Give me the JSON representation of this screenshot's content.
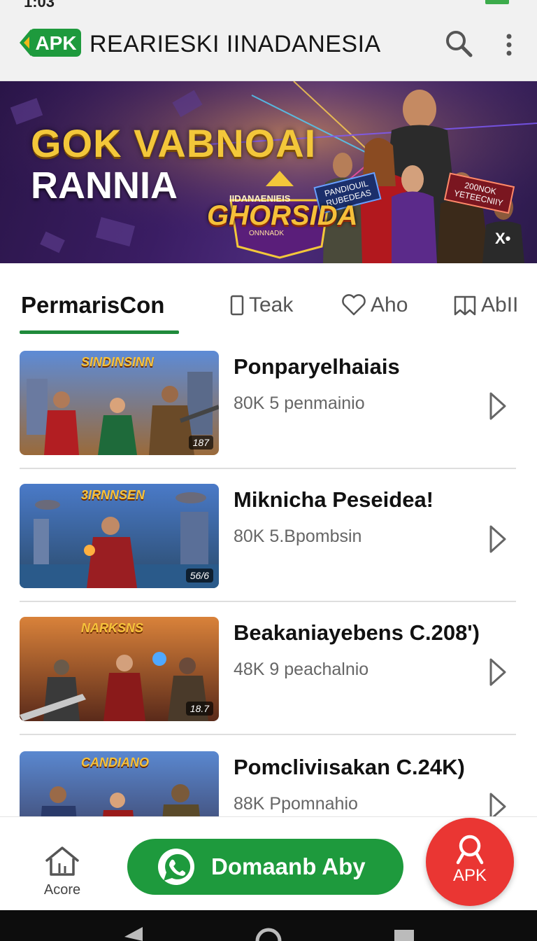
{
  "status_bar": {
    "time": "1:03"
  },
  "header": {
    "logo_text": "APK",
    "title": "REARIESKI IINADANESIA"
  },
  "banner": {
    "line1": "GOK VABNOAI",
    "line2": "RANNIA",
    "logo_top": "IIDANAENIEIS",
    "logo": "GHORSIDA",
    "logo_sub": "ONNNADK",
    "badge_left_line1": "PANDIOUIL",
    "badge_left_line2": "RUBEDEAS",
    "badge_right_line1": "200NOK",
    "badge_right_line2": "YETEECNIIY",
    "corner_mark": "X•"
  },
  "tabs": [
    {
      "label": "PermarisCon",
      "active": true
    },
    {
      "label": "Teak",
      "icon": "phone-icon"
    },
    {
      "label": "Aho",
      "icon": "heart-icon"
    },
    {
      "label": "AbII",
      "icon": "bookmark-icon"
    }
  ],
  "games": [
    {
      "name": "Ponparyelhaiais",
      "meta": "80K 5 penmainio",
      "thumb_title": "SINDINSINN",
      "thumb_badge": "187"
    },
    {
      "name": "Miknicha Peseidea!",
      "meta": "80K 5.Bpombsin",
      "thumb_title": "3IRNNSEN",
      "thumb_badge": "56/6"
    },
    {
      "name": "Beakaniayebens C.208')",
      "meta": "48K 9 peachalnio",
      "thumb_title": "NARKSNS",
      "thumb_badge": "18.7"
    },
    {
      "name": "Pomcliviısakan C.24K)",
      "meta": "88K Ppomnahio",
      "thumb_title": "CANDIANO",
      "thumb_badge": ""
    }
  ],
  "bottom_nav": {
    "home_label": "Acore",
    "download_label": "Domaanb Aby",
    "fab_label": "APK"
  },
  "colors": {
    "brand_green": "#1e9a3d",
    "fab_red": "#ea3633",
    "banner_purple": "#3a1d63",
    "title_gold": "#f3c73a"
  }
}
